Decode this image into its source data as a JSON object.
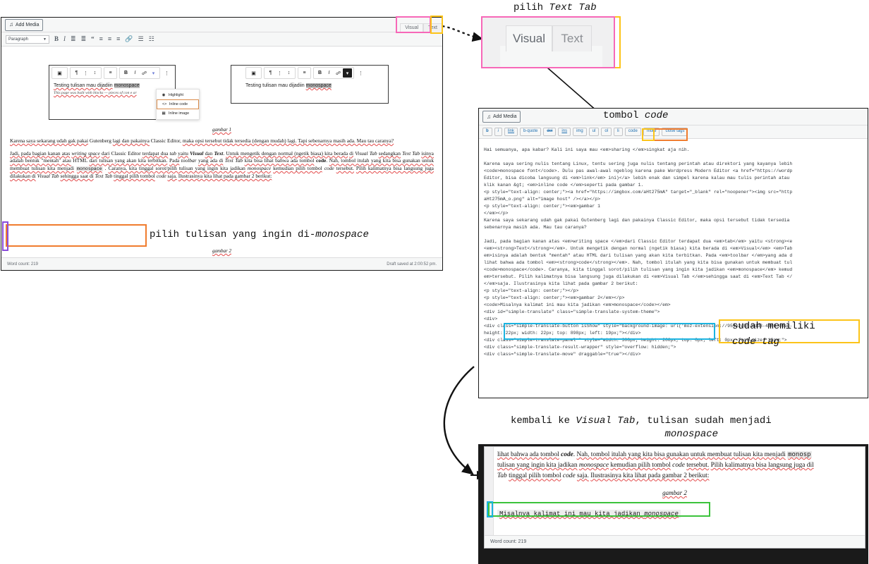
{
  "annotations": {
    "pilih_text_tab": "pilih Text Tab",
    "tombol_code": "tombol code",
    "pilih_tulisan": "pilih tulisan yang ingin di-monospace",
    "sudah_memiliki_l1": "sudah memiliki",
    "sudah_memiliki_l2": "code tag",
    "kembali_l1": "kembali ke Visual Tab, tulisan sudah menjadi",
    "kembali_l2": "monospace"
  },
  "colors": {
    "pink": "#f768b8",
    "yellow": "#fcc419",
    "orange": "#f07c2e",
    "purple": "#8a4ddb",
    "cyan": "#1bb3e0",
    "green": "#3cc33c",
    "wp_blue": "#2271b1",
    "highlight_gray": "#bdbdbd"
  },
  "left_editor": {
    "add_media": "Add Media",
    "add_media_icon": "media-icon",
    "tabs": [
      {
        "label": "Visual",
        "active": true
      },
      {
        "label": "Text",
        "active": false
      }
    ],
    "format_select": "Paragraph",
    "toolbar_icons": [
      "bold-icon",
      "italic-icon",
      "bulleted-list-icon",
      "numbered-list-icon",
      "blockquote-icon",
      "align-left-icon",
      "align-center-icon",
      "align-right-icon",
      "link-icon",
      "read-more-icon",
      "toolbar-toggle-icon"
    ],
    "caption1": "gambar 1",
    "caption2": "gambar 2",
    "paragraphs": [
      "Karena saya sekarang udah gak pakai Gutenberg lagi dan pakainya Classic Editor, maka opsi tersebut tidak tersedia (dengan mudah) lagi. Tapi sebenarnya masih ada. Mau tau caranya?",
      "Jadi, pada bagian kanan atas writing space dari Classic Editor terdapat dua tab yaitu Visual dan Text. Untuk mengetik dengan normal (ngetik biasa) kita berada di Visual Tab sedangkan Text Tab isinya adalah bentuk \"mentah\" atau HTML dari tulisan yang akan kita terbitkan. Pada toolbar yang ada di Text Tab kita bisa lihat bahwa ada tombol code. Nah, tombol itulah yang kita bisa gunakan untuk membuat tulisan kita menjadi monospace . Caranya, kita tinggal sorot/pilih tulisan yang ingin kita jadikan monospace kemudian pilih tombol code tersebut. Pilih kalimatnya bisa langsung juga dilakukan di Visual Tab sehingga saat di Text Tab tinggal pilih tombol code saja. Ilustrasinya kita lihat pada gambar 2 berikut:"
    ],
    "selected_sentence": "Misalnya kalimat ini mau kita jadikan monospace",
    "word_count": "Word count: 219",
    "draft_saved": "Draft saved at 2:00:52 pm."
  },
  "gutenberg_left": {
    "text": "Testing tulisan mau dijadiin monospace",
    "highlighted_word": "monospace",
    "subtext": "This page was built with blocks — pieces of con                   e ar",
    "toolbar_icons": [
      "block-type-icon",
      "paragraph-icon",
      "drag-handle-icon",
      "move-updown-icon",
      "align-icon",
      "bold-icon",
      "italic-icon",
      "link-icon",
      "chevron-down-icon",
      "more-options-icon"
    ],
    "menu_items": [
      {
        "label": "Highlight",
        "icon": "highlight-icon",
        "selected": false
      },
      {
        "label": "Inline code",
        "icon": "inline-code-icon",
        "selected": true
      },
      {
        "label": "Inline image",
        "icon": "inline-image-icon",
        "selected": false
      }
    ]
  },
  "gutenberg_right": {
    "text": "Testing tulisan mau dijadiin monospace",
    "highlighted_word": "monospace",
    "toolbar_icons": [
      "block-type-icon",
      "paragraph-icon",
      "drag-handle-icon",
      "move-updown-icon",
      "align-icon",
      "bold-icon",
      "italic-icon",
      "link-icon",
      "chevron-down-icon",
      "more-options-icon"
    ]
  },
  "tab_callout": {
    "tabs": [
      {
        "label": "Visual",
        "active": true
      },
      {
        "label": "Text",
        "active": false
      }
    ]
  },
  "text_editor": {
    "add_media": "Add Media",
    "quicktags": [
      "b",
      "i",
      "link",
      "b-quote",
      "del",
      "ins",
      "img",
      "ul",
      "ol",
      "li",
      "code",
      "more",
      "close tags"
    ],
    "highlighted_quicktag": "code",
    "code_lines": [
      "Hai semuanya, apa kabar? Kali ini saya mau <em>sharing </em>singkat aja nih.",
      "",
      "Karena saya sering nulis tentang Linux, tentu sering juga nulis tentang perintah atau direktori yang kayanya lebih",
      "<code>monospace font</code>. Dulu pas awal-awal ngeblog karena pake Wordpress Modern Editor <a href=\"https://wordp",
      "Editor, bisa dicoba langsung di <em>link</em> ini)</a> lebih enak dan simpel karena kalau mau tulis perintah atau ",
      "klik kanan &gt; <em>inline code </em>seperti pada gambar 1.",
      "<p style=\"text-align: center;\"><a href=\"https://imgbox.com/aHt275mA\" target=\"_blank\" rel=\"noopener\"><img src=\"http",
      "aHt275mA_o.png\" alt=\"image host\" /></a></p>",
      "<p style=\"text-align: center;\"><em>gambar 1",
      "</em></p>",
      "Karena saya sekarang udah gak pakai Gutenberg lagi dan pakainya Classic Editor, maka opsi tersebut tidak tersedia ",
      "sebenarnya masih ada. Mau tau caranya?",
      "",
      "Jadi, pada bagian kanan atas <em>writing space </em>dari Classic Editor terdapat dua <em>tab</em> yaitu <strong><e",
      "<em><strong>Text</strong></em>. Untuk mengetik dengan normal (ngetik biasa) kita berada di <em>Visual</em> <em>Tab",
      "em>isinya adalah bentuk \"mentah\" atau HTML dari tulisan yang akan kita terbitkan. Pada <em>toolbar </em>yang ada d",
      "lihat bahwa ada tombol <em><strong>code</strong></em>. Nah, tombol itulah yang kita bisa gunakan untuk membuat tul",
      "<code>monospace</code>. Caranya, kita tinggal sorot/pilih tulisan yang ingin kita jadikan <em>monospace</em> kemud",
      "em>tersebut. Pilih kalimatnya bisa langsung juga dilakukan di <em>Visual Tab </em>sehingga saat di <em>Text Tab </",
      "</em>saja. Ilustrasinya kita lihat pada gambar 2 berikut:",
      "<p style=\"text-align: center;\"></p>",
      "<p style=\"text-align: center;\"><em>gambar 2</em></p>",
      "<code>Misalnya kalimat ini mau kita jadikan <em>monospace</code></em>",
      "<div id=\"simple-translate\" class=\"simple-translate-system-theme\">",
      "<div>",
      "<div class=\"simple-translate-button isShow\" style=\"background-image: url('moz-extension://954e2d58-edd3-4840-b0ae-",
      "height: 22px; width: 22px; top: 898px; left: 19px;\"></div>",
      "<div class=\"simple-translate-panel \" style=\"width: 300px; height: 200px; top: 0px; left: 0px; font-size: 13px;\">",
      "<div class=\"simple-translate-result-wrapper\" style=\"overflow: hidden;\">",
      "<div class=\"simple-translate-move\" draggable=\"true\"></div>"
    ]
  },
  "result_editor": {
    "paragraph_lines": [
      "lihat bahwa ada tombol code. Nah, tombol itulah yang kita bisa gunakan untuk membuat tulisan kita menjadi  monosp",
      "tulisan yang ingin kita jadikan monospace kemudian pilih tombol code tersebut. Pilih kalimatnya bisa langsung juga dil",
      "Tab tinggal pilih tombol code saja. Ilustrasinya kita lihat pada gambar 2 berikut:"
    ],
    "caption": "gambar 2",
    "code_line": "Misalnya kalimat ini mau kita jadikan monospace",
    "word_count": "Word count: 219"
  }
}
